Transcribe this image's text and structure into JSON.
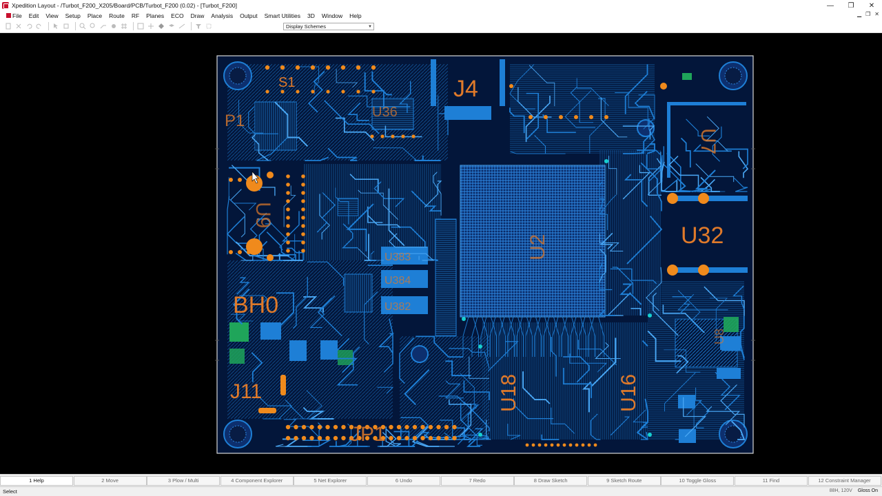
{
  "window": {
    "title": "Xpedition Layout - /Turbot_F200_X205/Board/PCB/Turbot_F200 (0.02) - [Turbot_F200]",
    "controls": [
      "—",
      "❐",
      "✕"
    ]
  },
  "menu": {
    "items": [
      "File",
      "Edit",
      "View",
      "Setup",
      "Place",
      "Route",
      "RF",
      "Planes",
      "ECO",
      "Draw",
      "Analysis",
      "Output",
      "Smart Utilities",
      "3D",
      "Window",
      "Help"
    ]
  },
  "toolbar": {
    "display_scheme": "Display Schemes"
  },
  "pcb": {
    "ref_labels": [
      "S1",
      "J4",
      "P1",
      "U36",
      "U32",
      "BH0",
      "J11",
      "JP1",
      "U18",
      "U16",
      "U2",
      "U383",
      "U384",
      "U382",
      "U7",
      "U8",
      "U9"
    ],
    "colors": {
      "board_fill": "#03163a",
      "trace": "#1e7fd6",
      "trace_light": "#4aa8f5",
      "pad": "#f08a1c",
      "silk": "#e07a2a",
      "green": "#1fa55a",
      "outline": "#d8d8d8"
    }
  },
  "fkeys": [
    "1 Help",
    "2 Move",
    "3 Plow / Multi",
    "4 Component Explorer",
    "5 Net Explorer",
    "6 Undo",
    "7 Redo",
    "8 Draw Sketch",
    "9 Sketch Route",
    "10 Toggle Gloss",
    "11 Find",
    "12 Constraint Manager"
  ],
  "status": {
    "mode": "Select",
    "info": "88H, 120V",
    "gloss": "Gloss On"
  }
}
